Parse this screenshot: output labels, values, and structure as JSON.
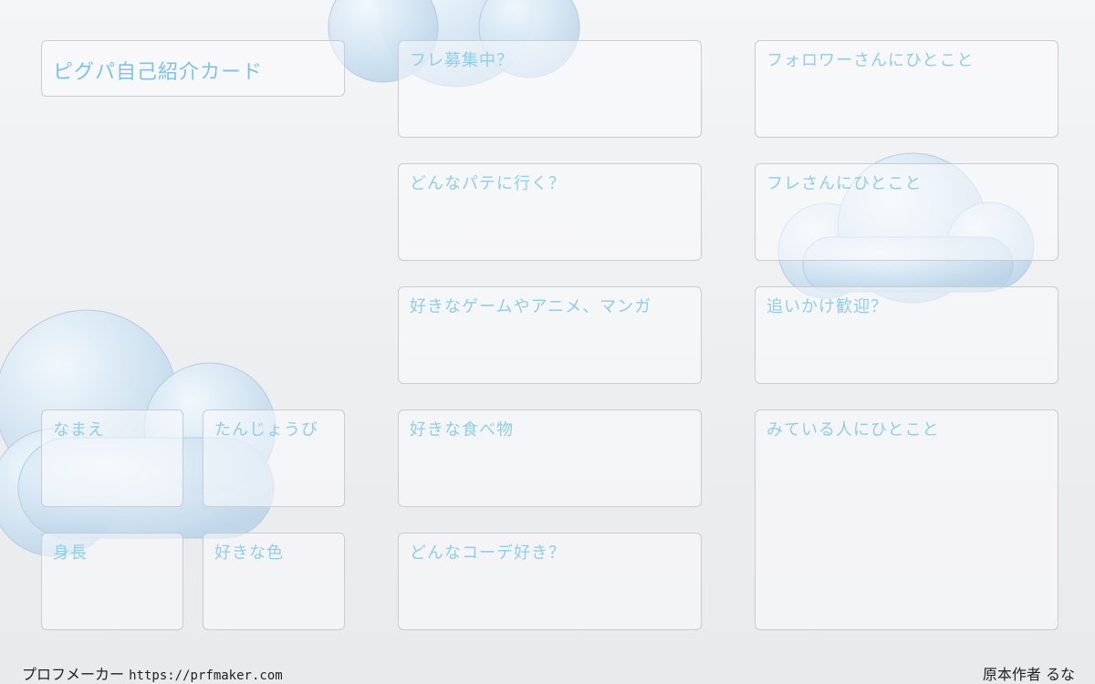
{
  "card": {
    "title": "ピグパ自己紹介カード",
    "fields": {
      "name": "なまえ",
      "birthday": "たんじょうび",
      "height": "身長",
      "favorite_color": "好きな色",
      "friend_recruit": "フレ募集中？",
      "party": "どんなパテに行く？",
      "favorite_media": "好きなゲームやアニメ、マンガ",
      "favorite_food": "好きな食べ物",
      "coordinate": "どんなコーデ好き？",
      "to_followers": "フォロワーさんにひとこと",
      "to_friends": "フレさんにひとこと",
      "follow_welcome": "追いかけ歓迎？",
      "to_viewers": "みている人にひとこと"
    }
  },
  "footer": {
    "maker": "プロフメーカー",
    "url": "https://prfmaker.com",
    "author": "原本作者 るな"
  },
  "colors": {
    "label": "#8fcdea",
    "border": "#c9ccd0",
    "cloud": "#cfe3f2"
  },
  "decorations": [
    "cloud-top",
    "cloud-right",
    "cloud-bottom-left"
  ]
}
